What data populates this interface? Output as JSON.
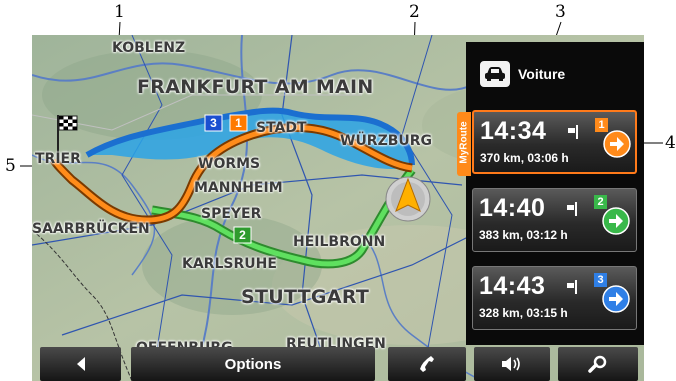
{
  "callouts": [
    "1",
    "2",
    "3",
    "4",
    "5"
  ],
  "map": {
    "cities": {
      "koblenz": "KOBLENZ",
      "frankfurt": "FRANKFURT AM MAIN",
      "darmstadt": "STADT",
      "wurzburg": "WÜRZBURG",
      "trier": "TRIER",
      "worms": "WORMS",
      "mannheim": "MANNHEIM",
      "speyer": "SPEYER",
      "saarbrucken": "SAARBRÜCKEN",
      "heilbronn": "HEILBRONN",
      "karlsruhe": "KARLSRUHE",
      "stuttgart": "STUTTGART",
      "offenburg": "OFFENBURG",
      "reutlingen": "REUTLINGEN"
    },
    "route_markers": [
      "3",
      "1",
      "2"
    ]
  },
  "panel": {
    "vehicle_label": "Voiture",
    "vehicle_icon": "car-icon",
    "myroute_label": "MyRoute",
    "routes": [
      {
        "number": "1",
        "time": "14:34",
        "details": "370 km, 03:06 h",
        "color": "#ff8a1a",
        "active": true
      },
      {
        "number": "2",
        "time": "14:40",
        "details": "383 km, 03:12 h",
        "color": "#39b84a",
        "active": false
      },
      {
        "number": "3",
        "time": "14:43",
        "details": "328 km, 03:15 h",
        "color": "#2f7fe6",
        "active": false
      }
    ]
  },
  "toolbar": {
    "options_label": "Options",
    "back_icon": "back-arrow-icon",
    "phone_icon": "phone-icon",
    "volume_icon": "volume-icon",
    "search_icon": "search-icon"
  }
}
